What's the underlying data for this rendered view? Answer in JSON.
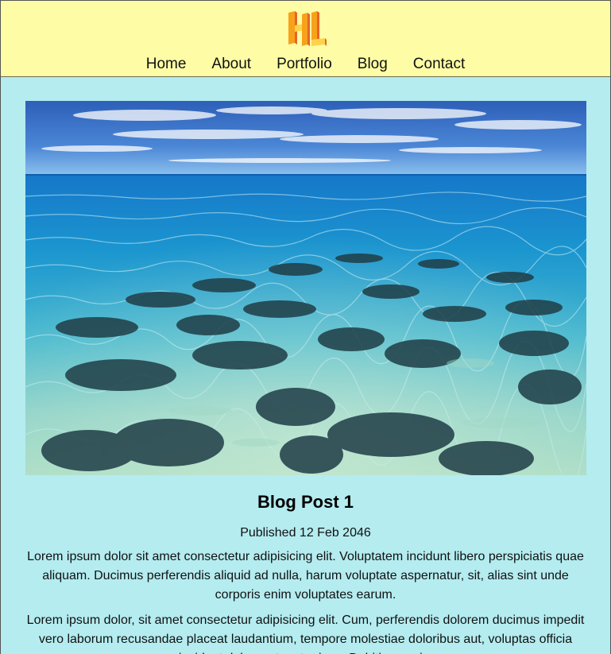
{
  "brand": {
    "logo_text": "HL",
    "logo_colors": {
      "primary": "#f7a21b",
      "shade": "#e8632a",
      "light": "#fcd34a"
    }
  },
  "nav": {
    "items": [
      {
        "label": "Home"
      },
      {
        "label": "About"
      },
      {
        "label": "Portfolio"
      },
      {
        "label": "Blog"
      },
      {
        "label": "Contact"
      }
    ]
  },
  "colors": {
    "header_bg": "#fefda6",
    "page_bg": "#b4ecf0"
  },
  "post": {
    "title": "Blog Post 1",
    "date": "Published 12 Feb 2046",
    "paragraphs": [
      "Lorem ipsum dolor sit amet consectetur adipisicing elit. Voluptatem incidunt libero perspiciatis quae aliquam. Ducimus perferendis aliquid ad nulla, harum voluptate aspernatur, sit, alias sint unde corporis enim voluptates earum.",
      "Lorem ipsum dolor, sit amet consectetur adipisicing elit. Cum, perferendis dolorem ducimus impedit vero laborum recusandae placeat laudantium, tempore molestiae doloribus aut, voluptas officia incidunt dolorem tenetur ipsa. Debitis, omnis."
    ],
    "image_alt": "Clear shallow turquoise sea over dark reef rocks under a blue sky"
  }
}
